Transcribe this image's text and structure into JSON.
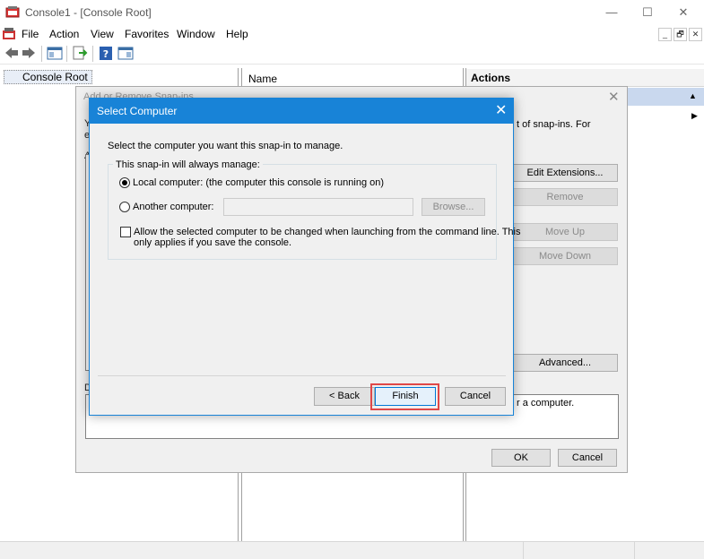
{
  "window": {
    "title": "Console1 - [Console Root]",
    "caption_minimize": "—",
    "caption_maximize": "☐",
    "caption_close": "✕"
  },
  "menu": {
    "items": [
      "File",
      "Action",
      "View",
      "Favorites",
      "Window",
      "Help"
    ],
    "mdi_minimize": "_",
    "mdi_restore": "🗗",
    "mdi_close": "✕"
  },
  "tree": {
    "root_label": "Console Root"
  },
  "list": {
    "column_name": "Name"
  },
  "actions": {
    "title": "Actions"
  },
  "snapin_dialog": {
    "title": "Add or Remove Snap-ins",
    "description_fragment": "t of snap-ins. For",
    "left_letter_1": "Y",
    "left_letter_2": "e",
    "left_letter_3": "A",
    "left_letter_4": "D",
    "edit_extensions": "Edit Extensions...",
    "remove": "Remove",
    "move_up": "Move Up",
    "move_down": "Move Down",
    "advanced": "Advanced...",
    "desc_text": "r a computer.",
    "ok": "OK",
    "cancel": "Cancel"
  },
  "select_computer": {
    "title": "Select Computer",
    "prompt": "Select the computer you want this snap-in to manage.",
    "group_label": "This snap-in will always manage:",
    "local_label": "Local computer:  (the computer this console is running on)",
    "another_label": "Another computer:",
    "another_value": "",
    "browse": "Browse...",
    "allow_line1": "Allow the selected computer to be changed when launching from the command line.  This",
    "allow_line2": "only applies if you save the console.",
    "local_selected": true,
    "allow_checked": false,
    "back": "< Back",
    "finish": "Finish",
    "cancel": "Cancel"
  },
  "colors": {
    "accent": "#1883d7",
    "highlight": "#e04848"
  }
}
